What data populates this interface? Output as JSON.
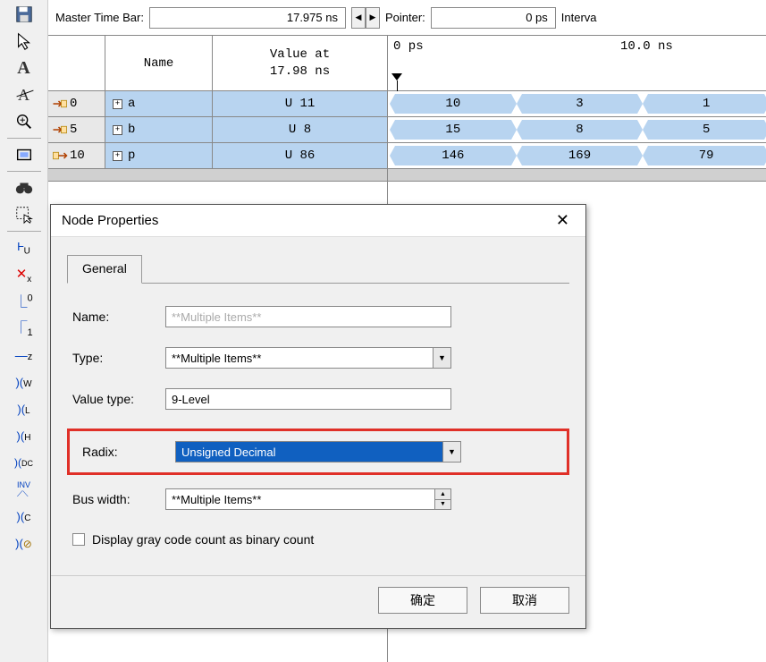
{
  "topbar": {
    "master_label": "Master Time Bar:",
    "master_value": "17.975 ns",
    "pointer_label": "Pointer:",
    "pointer_value": "0 ps",
    "interval_label": "Interva"
  },
  "sig_header": {
    "name": "Name",
    "value": "Value at\n17.98 ns"
  },
  "signals": [
    {
      "idx": "0",
      "name": "a",
      "value": "U 11",
      "kind": "in"
    },
    {
      "idx": "5",
      "name": "b",
      "value": "U 8",
      "kind": "in"
    },
    {
      "idx": "10",
      "name": "p",
      "value": "U 86",
      "kind": "out"
    }
  ],
  "ruler": {
    "t0": "0 ps",
    "t1": "10.0 ns"
  },
  "waves": [
    {
      "vals": [
        "10",
        "3",
        "1"
      ]
    },
    {
      "vals": [
        "15",
        "8",
        "5"
      ]
    },
    {
      "vals": [
        "146",
        "169",
        "79"
      ]
    }
  ],
  "dialog": {
    "title": "Node Properties",
    "tab": "General",
    "name_label": "Name:",
    "name_value": "**Multiple Items**",
    "type_label": "Type:",
    "type_value": "**Multiple Items**",
    "valuetype_label": "Value type:",
    "valuetype_value": "9-Level",
    "radix_label": "Radix:",
    "radix_value": "Unsigned Decimal",
    "buswidth_label": "Bus width:",
    "buswidth_value": "**Multiple Items**",
    "graycode_label": "Display gray code count as binary count",
    "ok": "确定",
    "cancel": "取消"
  },
  "toolbar_icons": [
    "save-icon",
    "cursor-icon",
    "text-icon",
    "text-crossed-icon",
    "zoom-in-icon",
    "fit-icon",
    "binoculars-icon",
    "select-area-icon",
    "xu-icon",
    "xx-icon",
    "zero-icon",
    "one-icon",
    "z-icon",
    "xw-icon",
    "xl-icon",
    "xh-icon",
    "xdc-icon",
    "inv-icon",
    "xc-icon",
    "xg-icon"
  ]
}
